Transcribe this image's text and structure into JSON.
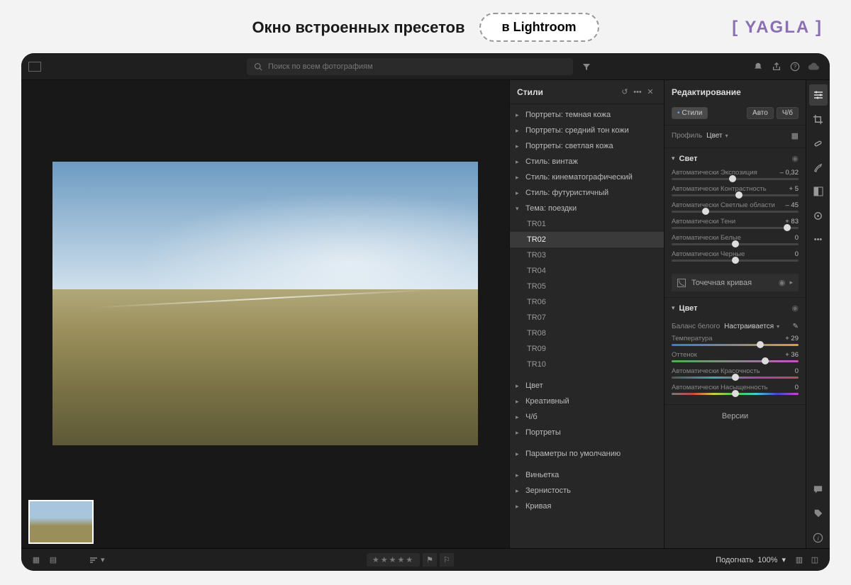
{
  "page": {
    "title": "Окно встроенных пресетов",
    "pill": "в Lightroom",
    "brand": "YAGLA"
  },
  "topbar": {
    "search_placeholder": "Поиск по всем фотографиям"
  },
  "presets": {
    "title": "Стили",
    "groups_top": [
      "Портреты: темная кожа",
      "Портреты: средний тон кожи",
      "Портреты: светлая кожа",
      "Стиль: винтаж",
      "Стиль: кинематографический",
      "Стиль: футуристичный"
    ],
    "expanded_group": "Тема: поездки",
    "items": [
      "TR01",
      "TR02",
      "TR03",
      "TR04",
      "TR05",
      "TR06",
      "TR07",
      "TR08",
      "TR09",
      "TR10"
    ],
    "selected": "TR02",
    "groups_mid": [
      "Цвет",
      "Креативный",
      "Ч/б",
      "Портреты"
    ],
    "defaults_group": "Параметры по умолчанию",
    "groups_bottom": [
      "Виньетка",
      "Зернистость",
      "Кривая"
    ]
  },
  "edit": {
    "title": "Редактирование",
    "chip_styles": "Стили",
    "chip_auto": "Авто",
    "chip_bw": "Ч/б",
    "profile_label": "Профиль",
    "profile_value": "Цвет",
    "section_light": "Свет",
    "auto_prefix": "Автоматически",
    "sliders_light": [
      {
        "name": "Экспозиция",
        "value": "– 0,32",
        "pos": 48
      },
      {
        "name": "Контрастность",
        "value": "+ 5",
        "pos": 53
      },
      {
        "name": "Светлые области",
        "value": "– 45",
        "pos": 27
      },
      {
        "name": "Тени",
        "value": "+ 83",
        "pos": 91
      },
      {
        "name": "Белые",
        "value": "0",
        "pos": 50
      },
      {
        "name": "Черные",
        "value": "0",
        "pos": 50
      }
    ],
    "point_curve": "Точечная кривая",
    "section_color": "Цвет",
    "wb_label": "Баланс белого",
    "wb_value": "Настраивается",
    "sliders_color": [
      {
        "name": "Температура",
        "value": "+ 29",
        "pos": 70,
        "cls": "temp"
      },
      {
        "name": "Оттенок",
        "value": "+ 36",
        "pos": 74,
        "cls": "tint"
      },
      {
        "name": "Красочность",
        "value": "0",
        "pos": 50,
        "cls": "vib",
        "auto": true
      },
      {
        "name": "Насыщенность",
        "value": "0",
        "pos": 50,
        "cls": "sat",
        "auto": true
      }
    ],
    "versions": "Версии"
  },
  "bottombar": {
    "fit_label": "Подогнать",
    "zoom": "100%"
  }
}
